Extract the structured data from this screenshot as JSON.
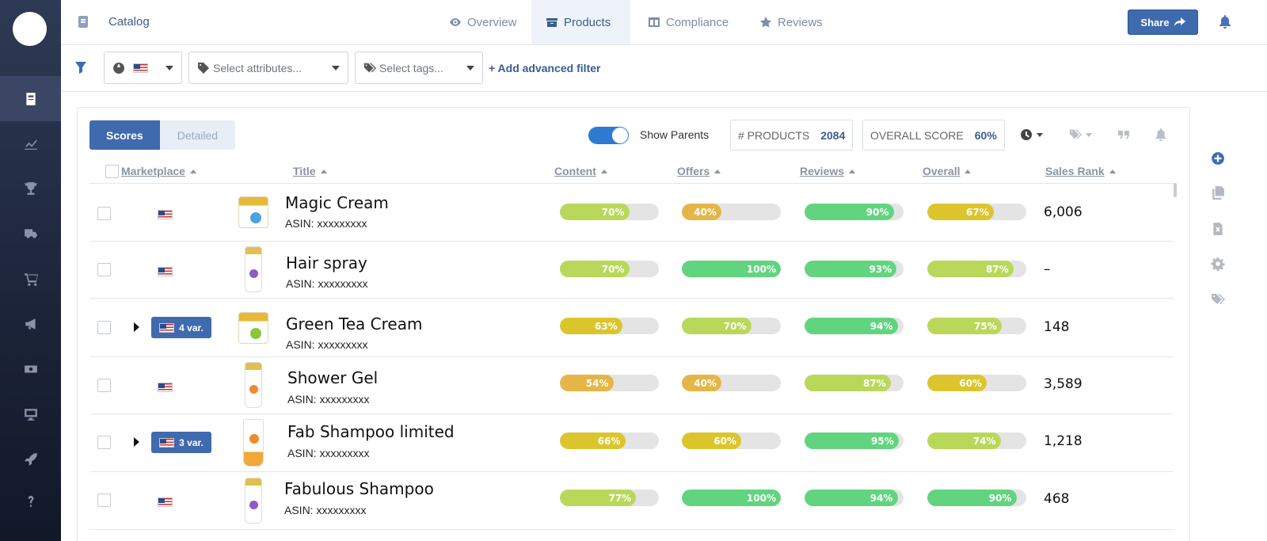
{
  "topbar": {
    "breadcrumb": "Catalog",
    "tabs": [
      {
        "label": "Overview",
        "icon": "eye-icon",
        "active": false
      },
      {
        "label": "Products",
        "icon": "box-icon",
        "active": true
      },
      {
        "label": "Compliance",
        "icon": "columns-icon",
        "active": false
      },
      {
        "label": "Reviews",
        "icon": "star-icon",
        "active": false
      }
    ],
    "share_label": "Share"
  },
  "sidebar": {
    "items": [
      "catalog-icon",
      "chart-icon",
      "trophy-icon",
      "truck-icon",
      "cart-icon",
      "megaphone-icon",
      "money-icon",
      "monitor-icon",
      "rocket-icon",
      "question-icon"
    ]
  },
  "filters": {
    "marketplace_flag": "us-flag-icon",
    "attributes_placeholder": "Select attributes...",
    "tags_placeholder": "Select tags...",
    "add_filter": "+ Add advanced filter"
  },
  "panel": {
    "view_toggle": {
      "scores": "Scores",
      "detailed": "Detailed"
    },
    "show_parents": "Show Parents",
    "products_label": "# PRODUCTS",
    "products_count": "2084",
    "score_label": "OVERALL SCORE",
    "score_value": "60%"
  },
  "table": {
    "columns": [
      "Marketplace",
      "Title",
      "Content",
      "Offers",
      "Reviews",
      "Overall",
      "Sales Rank"
    ],
    "rows": [
      {
        "name": "Magic Cream",
        "asin": "ASIN: xxxxxxxxx",
        "variations": "",
        "content": "70%",
        "offers": "40%",
        "reviews": "90%",
        "overall": "67%",
        "rank": "6,006"
      },
      {
        "name": "Hair spray",
        "asin": "ASIN: xxxxxxxxx",
        "variations": "",
        "content": "70%",
        "offers": "100%",
        "reviews": "93%",
        "overall": "87%",
        "rank": "–"
      },
      {
        "name": "Green Tea Cream",
        "asin": "ASIN: xxxxxxxxx",
        "variations": "4 var.",
        "content": "63%",
        "offers": "70%",
        "reviews": "94%",
        "overall": "75%",
        "rank": "148"
      },
      {
        "name": "Shower Gel",
        "asin": "ASIN: xxxxxxxxx",
        "variations": "",
        "content": "54%",
        "offers": "40%",
        "reviews": "87%",
        "overall": "60%",
        "rank": "3,589"
      },
      {
        "name": "Fab Shampoo limited",
        "asin": "ASIN: xxxxxxxxx",
        "variations": "3 var.",
        "content": "66%",
        "offers": "60%",
        "reviews": "95%",
        "overall": "74%",
        "rank": "1,218"
      },
      {
        "name": "Fabulous Shampoo",
        "asin": "ASIN: xxxxxxxxx",
        "variations": "",
        "content": "77%",
        "offers": "100%",
        "reviews": "94%",
        "overall": "90%",
        "rank": "468"
      }
    ]
  },
  "colors": {
    "primary": "#3f6aae",
    "score_orange": "#e5b647",
    "score_yellow": "#dcc52c",
    "score_lime": "#b9d85a",
    "score_green": "#62d47f"
  },
  "right_rail": [
    "add-circle-icon",
    "copy-icon",
    "excel-icon",
    "gear-icon",
    "tags-icon"
  ]
}
